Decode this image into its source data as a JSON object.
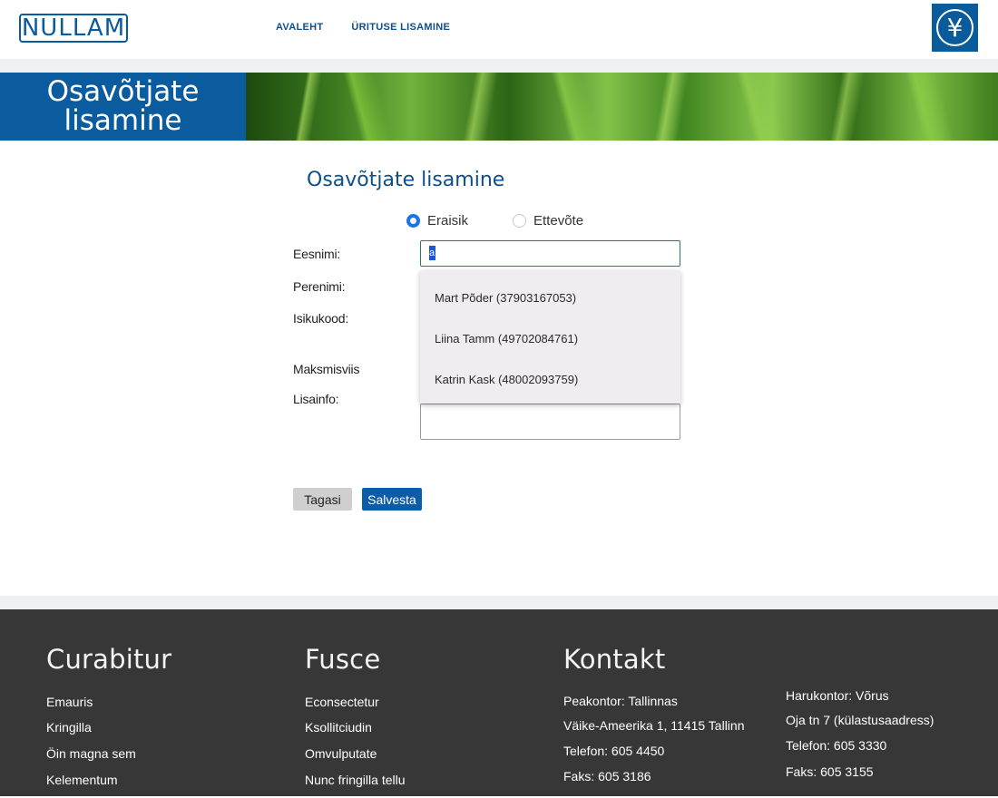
{
  "header": {
    "logo_text": "NULLAM",
    "nav": [
      {
        "label": "AVALEHT"
      },
      {
        "label": "ÜRITUSE LISAMINE"
      }
    ],
    "emblem_glyph": "¥"
  },
  "banner": {
    "title_line1": "Osavõtjate",
    "title_line2": "lisamine"
  },
  "form": {
    "title": "Osavõtjate lisamine",
    "radio_options": [
      {
        "label": "Eraisik",
        "checked": true
      },
      {
        "label": "Ettevõte",
        "checked": false
      }
    ],
    "labels": {
      "first_name": "Eesnimi:",
      "last_name": "Perenimi:",
      "id_code": "Isikukood:",
      "payment": "Maksmisviis",
      "extra_info": "Lisainfo:"
    },
    "first_name_value": "a",
    "autocomplete": [
      {
        "label": "Mart Põder (37903167053)"
      },
      {
        "label": "Liina Tamm (49702084761)"
      },
      {
        "label": "Katrin Kask (48002093759)"
      }
    ],
    "back_label": "Tagasi",
    "save_label": "Salvesta"
  },
  "footer": {
    "col1": {
      "heading": "Curabitur",
      "links": [
        "Emauris",
        "Kringilla",
        "Öin magna sem",
        "Kelementum"
      ]
    },
    "col2": {
      "heading": "Fusce",
      "links": [
        "Econsectetur",
        "Ksollitciudin",
        "Omvulputate",
        "Nunc fringilla tellu"
      ]
    },
    "col3": {
      "heading": "Kontakt",
      "lines": [
        "Peakontor: Tallinnas",
        "Väike-Ameerika 1, 11415 Tallinn",
        "Telefon: 605 4450",
        "Faks: 605 3186"
      ]
    },
    "col4": {
      "lines": [
        "Harukontor: Võrus",
        "Oja tn 7 (külastusaadress)",
        "Telefon: 605 3330",
        "Faks: 605 3155"
      ]
    }
  },
  "colors": {
    "primary_blue": "#0a5c9f",
    "footer_bg": "#373737"
  }
}
